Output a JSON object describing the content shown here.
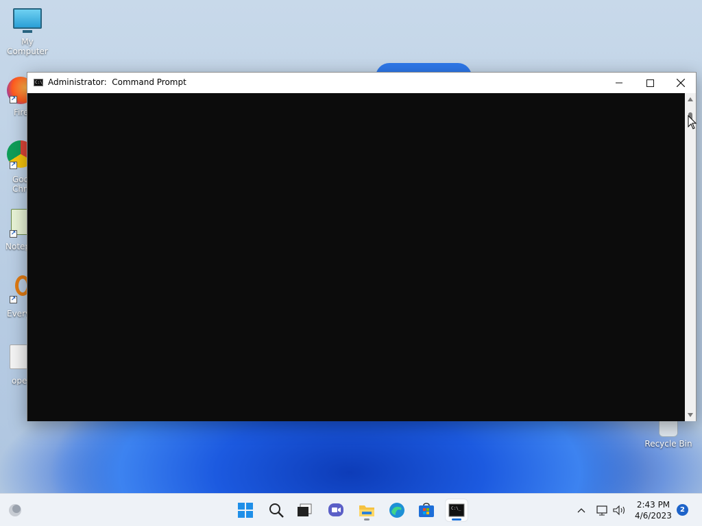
{
  "desktop": {
    "icons": [
      {
        "label": "My Computer"
      },
      {
        "label": "Fire"
      },
      {
        "label": "Goo\nChro"
      },
      {
        "label": "Notep"
      },
      {
        "label": "Every"
      },
      {
        "label": "ope"
      },
      {
        "label": "Recycle Bin"
      }
    ]
  },
  "window": {
    "title": "Administrator:  Command Prompt",
    "icon": "cmd-icon"
  },
  "taskbar": {
    "apps": [
      {
        "name": "start-button",
        "icon": "windows-logo-icon"
      },
      {
        "name": "search-button",
        "icon": "search-icon"
      },
      {
        "name": "task-view-button",
        "icon": "task-view-icon"
      },
      {
        "name": "teams-button",
        "icon": "chat-camera-icon"
      },
      {
        "name": "file-explorer-button",
        "icon": "folder-icon"
      },
      {
        "name": "edge-button",
        "icon": "edge-icon"
      },
      {
        "name": "store-button",
        "icon": "store-icon"
      },
      {
        "name": "command-prompt-button",
        "icon": "cmd-icon"
      }
    ],
    "clock": {
      "time": "2:43 PM",
      "date": "4/6/2023"
    },
    "notification_count": "2"
  },
  "colors": {
    "console_bg": "#0c0c0c",
    "taskbar_bg": "#eef2f7",
    "accent": "#1a6fd6"
  }
}
